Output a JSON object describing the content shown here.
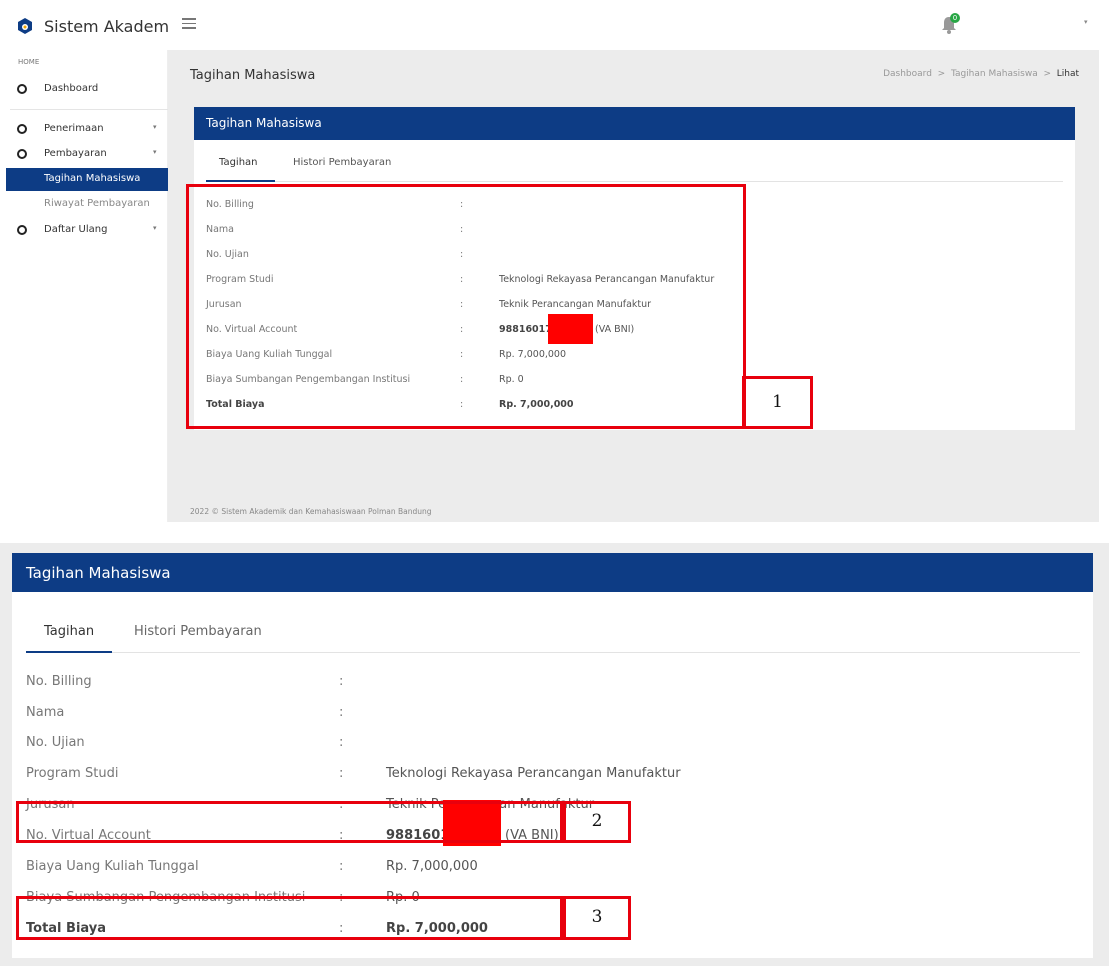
{
  "app": {
    "title": "Sistem Akademik"
  },
  "notifications": {
    "count": "0"
  },
  "sidebar": {
    "section": "HOME",
    "dashboard": "Dashboard",
    "penerimaan": "Penerimaan",
    "pembayaran": "Pembayaran",
    "tagihan": "Tagihan Mahasiswa",
    "riwayat": "Riwayat Pembayaran",
    "daftar_ulang": "Daftar Ulang"
  },
  "page": {
    "title": "Tagihan Mahasiswa"
  },
  "breadcrumb": {
    "home": "Dashboard",
    "sep": ">",
    "section": "Tagihan Mahasiswa",
    "current": "Lihat"
  },
  "card": {
    "title": "Tagihan Mahasiswa",
    "tabs": [
      "Tagihan",
      "Histori Pembayaran"
    ],
    "colon": ":",
    "rows": [
      {
        "label": "No. Billing",
        "value": ""
      },
      {
        "label": "Nama",
        "value": ""
      },
      {
        "label": "No. Ujian",
        "value": ""
      },
      {
        "label": "Program Studi",
        "value": "Teknologi Rekayasa Perancangan Manufaktur"
      },
      {
        "label": "Jurusan",
        "value": "Teknik Perancangan Manufaktur"
      },
      {
        "label": "No. Virtual Account",
        "value": "98816017",
        "suffix": "(VA BNI)"
      },
      {
        "label": "Biaya Uang Kuliah Tunggal",
        "value": "Rp. 7,000,000"
      },
      {
        "label": "Biaya Sumbangan Pengembangan Institusi",
        "value": "Rp. 0"
      },
      {
        "label": "Total Biaya",
        "value": "Rp. 7,000,000"
      }
    ]
  },
  "footer": {
    "text": "2022 © Sistem Akademik dan Kemahasiswaan Polman Bandung"
  },
  "annotations": {
    "n1": "1",
    "n2": "2",
    "n3": "3"
  },
  "colors": {
    "primary": "#0d3c85",
    "highlight": "#e8000d",
    "redact": "#ff0000",
    "badge": "#28a745"
  }
}
